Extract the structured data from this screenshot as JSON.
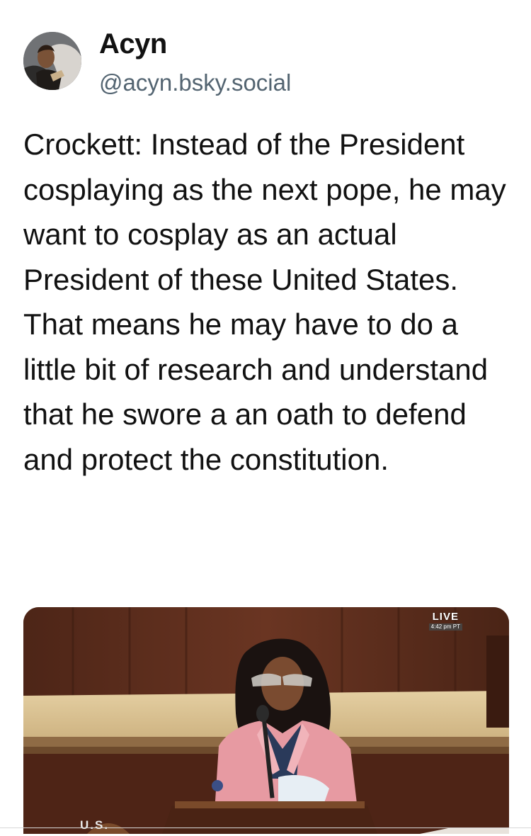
{
  "post": {
    "author": {
      "display_name": "Acyn",
      "handle": "@acyn.bsky.social",
      "avatar_icon": "user-avatar-photo"
    },
    "text": "Crockett: Instead of the President cosplaying as the next pope, he may want to cosplay as an actual President of these United States. That means he may have to do a little bit of research and understand that he swore a an oath to defend and protect the constitution.",
    "media": {
      "kind": "video-still",
      "description_icon": "house-floor-speaker-still",
      "live_label": "LIVE",
      "live_time": "4:42 pm PT",
      "caption_fragment": "U.S."
    }
  },
  "colors": {
    "text": "#111111",
    "handle": "#536471",
    "jacket": "#e79aa2",
    "wood": "#5b2d1c"
  }
}
